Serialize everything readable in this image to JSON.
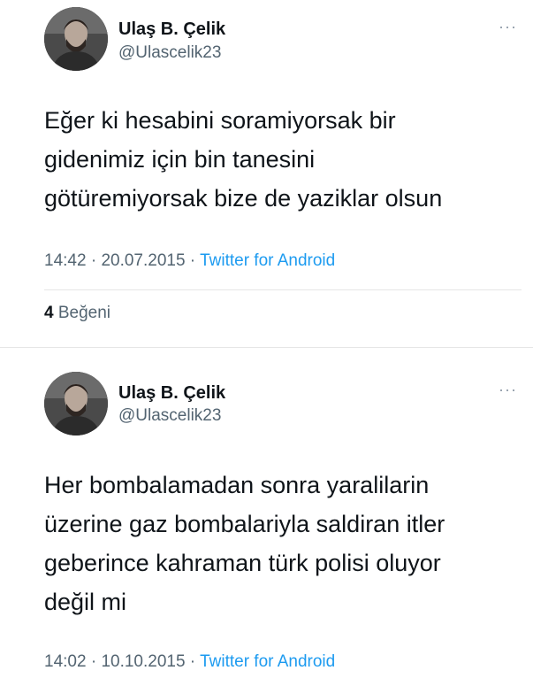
{
  "tweets": [
    {
      "name": "Ulaş B. Çelik",
      "handle": "@Ulascelik23",
      "more": "···",
      "lines": [
        "Eğer ki hesabini soramiyorsak bir",
        "gidenimiz için bin tanesini",
        "götüremiyorsak bize de yaziklar olsun"
      ],
      "time": "14:42",
      "date": "20.07.2015",
      "source": "Twitter for Android",
      "likes_count": "4",
      "likes_label": "Beğeni"
    },
    {
      "name": "Ulaş B. Çelik",
      "handle": "@Ulascelik23",
      "more": "···",
      "lines": [
        "Her bombalamadan sonra yaralilarin",
        "üzerine gaz bombalariyla saldiran itler",
        "geberince kahraman türk polisi oluyor",
        "değil mi"
      ],
      "time": "14:02",
      "date": "10.10.2015",
      "source": "Twitter for Android"
    }
  ],
  "separator": " · ",
  "colors": {
    "text": "#0f1419",
    "secondary": "#536471",
    "link": "#1d9bf0",
    "divider": "#e6e6e6"
  }
}
